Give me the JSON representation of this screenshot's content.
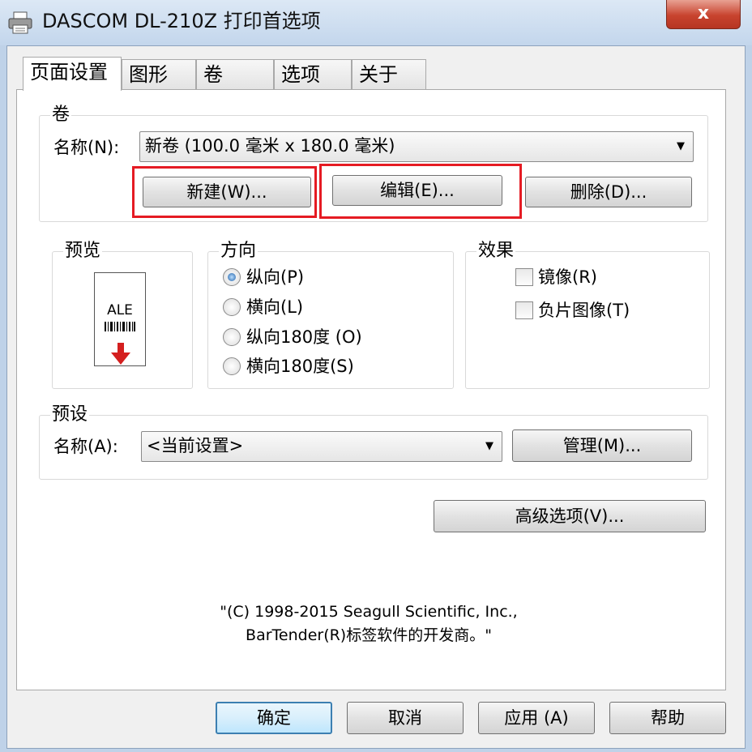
{
  "window": {
    "title": "DASCOM DL-210Z 打印首选项",
    "close_glyph": "x"
  },
  "tabs": [
    {
      "label": "页面设置"
    },
    {
      "label": "图形"
    },
    {
      "label": "卷"
    },
    {
      "label": "选项"
    },
    {
      "label": "关于"
    }
  ],
  "roll_group": {
    "title": "卷",
    "name_label": "名称(N):",
    "name_value": "新卷 (100.0 毫米 x 180.0 毫米)",
    "new_button": "新建(W)...",
    "edit_button": "编辑(E)...",
    "delete_button": "删除(D)..."
  },
  "preview_group": {
    "title": "预览",
    "sample_text": "ALE"
  },
  "orientation_group": {
    "title": "方向",
    "options": [
      {
        "label": "纵向(P)",
        "selected": true
      },
      {
        "label": "横向(L)",
        "selected": false
      },
      {
        "label": "纵向180度 (O)",
        "selected": false
      },
      {
        "label": "横向180度(S)",
        "selected": false
      }
    ]
  },
  "effects_group": {
    "title": "效果",
    "options": [
      {
        "label": "镜像(R)",
        "checked": false
      },
      {
        "label": "负片图像(T)",
        "checked": false
      }
    ]
  },
  "preset_group": {
    "title": "预设",
    "name_label": "名称(A):",
    "name_value": "<当前设置>",
    "manage_button": "管理(M)..."
  },
  "advanced_button": "高级选项(V)...",
  "copyright": {
    "line1": "\"(C) 1998-2015 Seagull Scientific, Inc.,",
    "line2": "BarTender(R)标签软件的开发商。\""
  },
  "dialog_buttons": {
    "ok": "确定",
    "cancel": "取消",
    "apply": "应用 (A)",
    "help": "帮助"
  },
  "colors": {
    "highlight_box": "#e51b23",
    "preview_arrow": "#d41f1f",
    "default_button_border": "#3c7fb1"
  },
  "icons": {
    "title": "printer-icon",
    "close": "close-icon",
    "dropdown": "chevron-down-icon"
  }
}
